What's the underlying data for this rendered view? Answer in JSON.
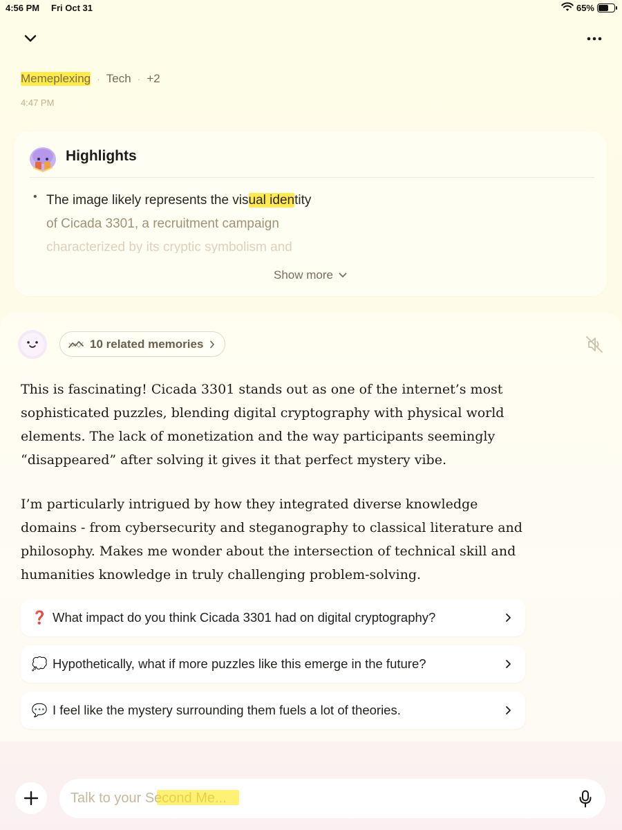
{
  "status_bar": {
    "time": "4:56 PM",
    "date": "Fri Oct 31",
    "battery": "65%",
    "battery_level": 0.65
  },
  "header": {
    "back_icon": "chevron-down-icon",
    "more_icon": "more-horizontal-icon"
  },
  "tags": {
    "items": [
      "Memeplexing",
      "Tech",
      "+2"
    ],
    "separator": "·"
  },
  "timestamp": "4:47 PM",
  "highlights": {
    "title": "Highlights",
    "bullet": "•",
    "line1_before": "The image likely represents the vis",
    "line1_highlight": "ual iden",
    "line1_after": "tity",
    "line2": "of Cicada 3301, a recruitment campaign",
    "line3": "characterized by its cryptic symbolism and",
    "show_more": "Show more"
  },
  "reply": {
    "memories_label": "10 related memories",
    "paragraph1": "This is fascinating! Cicada 3301 stands out as one of the internet’s most sophisticated puzzles, blending digital cryptography with physical world elements. The lack of monetization and the way participants seemingly “disappeared” after solving it gives it that perfect mystery vibe.",
    "paragraph2": "I’m particularly intrigued by how they integrated diverse knowledge domains - from cybersecurity and steganography to classical literature and philosophy. Makes me wonder about the intersection of technical skill and humanities knowledge in truly challenging problem-solving."
  },
  "suggestions": [
    {
      "emoji": "❓",
      "text": "What impact do you think Cicada 3301 had on digital cryptography?"
    },
    {
      "emoji": "💭",
      "text": "Hypothetically, what if more puzzles like this emerge in the future?"
    },
    {
      "emoji": "💬",
      "text": "I feel like the mystery surrounding them fuels a lot of theories."
    }
  ],
  "input": {
    "placeholder": "Talk to your Second Me..."
  },
  "colors": {
    "highlighter": "#ffe600",
    "accent_text": "#7a6a52",
    "background_top": "#fefde8",
    "background_bottom": "#fbeff2"
  }
}
